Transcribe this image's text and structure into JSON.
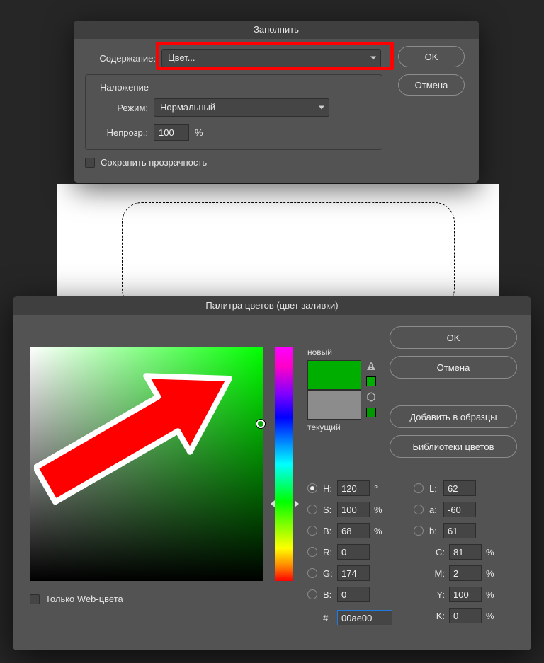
{
  "fill": {
    "title": "Заполнить",
    "content_label": "Содержание:",
    "content_value": "Цвет...",
    "blending": {
      "legend": "Наложение",
      "mode_label": "Режим:",
      "mode_value": "Нормальный",
      "opacity_label": "Непрозр.:",
      "opacity_value": "100",
      "opacity_unit": "%"
    },
    "preserve_transparency": "Сохранить прозрачность",
    "ok": "OK",
    "cancel": "Отмена"
  },
  "picker": {
    "title": "Палитра цветов (цвет заливки)",
    "new_label": "новый",
    "current_label": "текущий",
    "new_color": "#00ae00",
    "current_color": "#8c8c8c",
    "buttons": {
      "ok": "OK",
      "cancel": "Отмена",
      "add": "Добавить в образцы",
      "libs": "Библиотеки цветов"
    },
    "fields": {
      "H": "120",
      "S": "100",
      "Bv": "68",
      "R": "0",
      "G": "174",
      "Bb": "0",
      "L": "62",
      "a": "-60",
      "b": "61",
      "C": "81",
      "M": "2",
      "Y": "100",
      "K": "0",
      "hex": "00ae00",
      "deg": "°",
      "pct": "%"
    },
    "labels": {
      "H": "H:",
      "S": "S:",
      "B": "B:",
      "R": "R:",
      "G": "G:",
      "L": "L:",
      "a": "a:",
      "b": "b:",
      "C": "C:",
      "M": "M:",
      "Y": "Y:",
      "K": "K:",
      "hash": "#"
    },
    "web_only": "Только Web-цвета"
  }
}
